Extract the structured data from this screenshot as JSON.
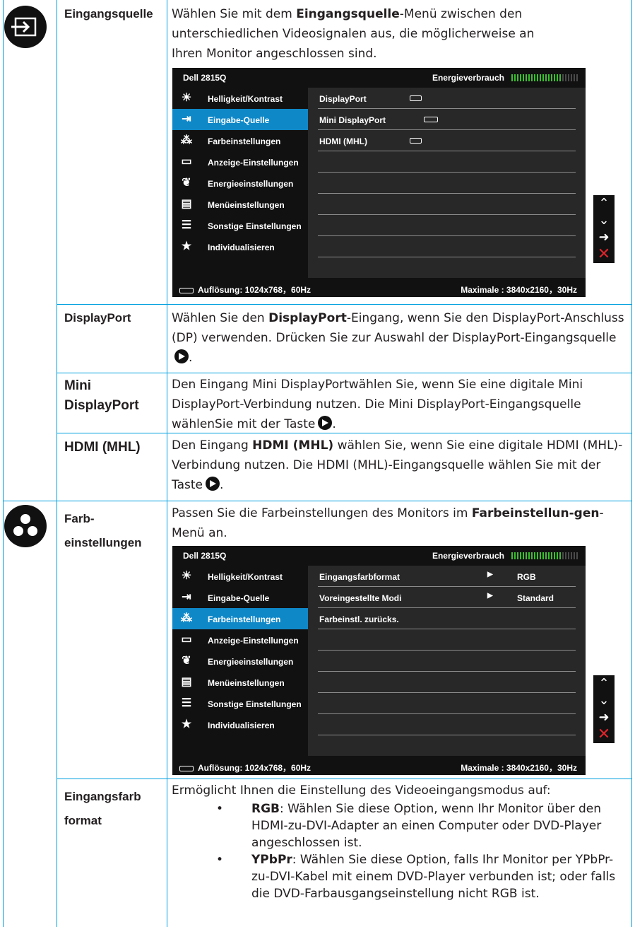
{
  "sec1": {
    "label": "Eingangsquelle",
    "desc": [
      {
        "t": "Wählen Sie mit dem ",
        "b": false
      },
      {
        "t": "Eingangsquelle",
        "b": true
      },
      {
        "t": "-Menü zwischen den unterschiedlichen Videosignalen aus, die möglicherweise an Ihren Monitor angeschlossen sind.",
        "b": false
      }
    ]
  },
  "osd1": {
    "model": "Dell 2815Q",
    "energy": "Energieverbrauch",
    "menu": [
      "Helligkeit/Kontrast",
      "Eingabe-Quelle",
      "Farbeinstellungen",
      "Anzeige-Einstellungen",
      "Energieeinstellungen",
      "Menüeinstellungen",
      "Sonstige Einstellungen",
      "Individualisieren"
    ],
    "rows": [
      "DisplayPort",
      "Mini DisplayPort",
      "HDMI (MHL)"
    ],
    "res": "Auflösung: 1024x768，60Hz",
    "max": "Maximale : 3840x2160，30Hz"
  },
  "dp": {
    "label": "DisplayPort",
    "d1": "Wählen Sie den ",
    "d2": "DisplayPort",
    "d3": "-Eingang, wenn Sie den DisplayPort-Anschluss (DP) verwenden. Drücken Sie zur Auswahl der DisplayPort-Eingangsquelle"
  },
  "mdp": {
    "label1": "Mini",
    "label2": "DisplayPort",
    "desc": "Den Eingang Mini DisplayPortwählen Sie, wenn Sie eine digitale Mini DisplayPort-Verbindung nutzen. Die Mini DisplayPort-Eingangsquelle wählenSie mit der Taste",
    "end": "."
  },
  "hdmi": {
    "label": "HDMI (MHL)",
    "d1": "Den Eingang ",
    "d2": "HDMI (MHL)",
    "d3": " wählen Sie, wenn Sie eine digitale HDMI (MHL)-Verbindung nutzen. Die HDMI (MHL)-Eingangsquelle wählen Sie mit der Taste"
  },
  "farb": {
    "label1": "Farb-",
    "label2": "einstellungen",
    "d1": "Passen Sie die Farbeinstellungen des Monitors im ",
    "d2": "Farbeinstellun-gen",
    "d3": "-Menü an."
  },
  "osd2": {
    "model": "Dell 2815Q",
    "energy": "Energieverbrauch",
    "menu": [
      "Helligkeit/Kontrast",
      "Eingabe-Quelle",
      "Farbeinstellungen",
      "Anzeige-Einstellungen",
      "Energieeinstellungen",
      "Menüeinstellungen",
      "Sonstige Einstellungen",
      "Individualisieren"
    ],
    "rows": [
      {
        "name": "Eingangsfarbformat",
        "arrow": "▶",
        "value": "RGB"
      },
      {
        "name": "Voreingestellte Modi",
        "arrow": "▶",
        "value": "Standard"
      },
      {
        "name": "Farbeinstl. zurücks.",
        "arrow": "",
        "value": ""
      }
    ],
    "res": "Auflösung: 1024x768，60Hz",
    "max": "Maximale : 3840x2160，30Hz"
  },
  "nav": {
    "up": "⌃",
    "down": "⌄",
    "right": "➜",
    "close": "✕"
  },
  "ef": {
    "label1": "Eingangsfarb",
    "label2": "format",
    "intro": "Ermöglicht Ihnen die Einstellung des Videoeingangsmodus auf:",
    "bullet_char": "•",
    "b1_key": "RGB",
    "b1_text": ": Wählen Sie diese Option, wenn Ihr Monitor über den HDMI-zu-DVI-Adapter an einen Computer oder DVD-Player angeschlossen ist.",
    "b2_key": "YPbPr",
    "b2_text": ": Wählen Sie diese Option, falls Ihr Monitor per YPbPr-zu-DVI-Kabel mit einem DVD-Player verbunden ist; oder falls die DVD-Farbausgangseinstellung nicht RGB ist."
  }
}
